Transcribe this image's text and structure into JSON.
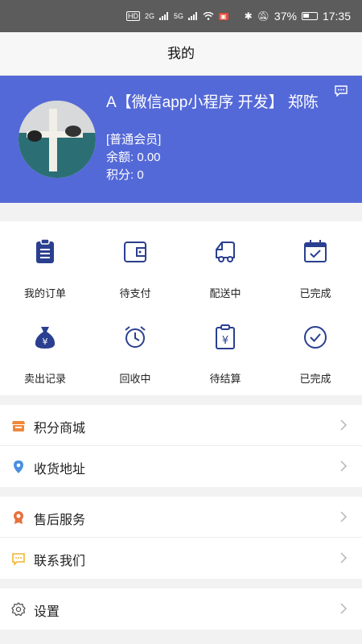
{
  "status_bar": {
    "battery_percent": "37%",
    "time": "17:35",
    "network_labels": [
      "HD",
      "2G",
      "5G"
    ]
  },
  "header": {
    "title": "我的"
  },
  "profile": {
    "name": "A【微信app小程序 开发】 郑陈",
    "level": "[普通会员]",
    "balance": "余额: 0.00",
    "points": "积分: 0"
  },
  "orders": {
    "row1": [
      {
        "label": "我的订单",
        "icon": "clipboard-list-icon"
      },
      {
        "label": "待支付",
        "icon": "wallet-icon"
      },
      {
        "label": "配送中",
        "icon": "truck-icon"
      },
      {
        "label": "已完成",
        "icon": "calendar-check-icon"
      }
    ],
    "row2": [
      {
        "label": "卖出记录",
        "icon": "money-bag-icon"
      },
      {
        "label": "回收中",
        "icon": "alarm-clock-icon"
      },
      {
        "label": "待结算",
        "icon": "yuan-clipboard-icon"
      },
      {
        "label": "已完成",
        "icon": "check-circle-icon"
      }
    ]
  },
  "menu": {
    "group1": [
      {
        "label": "积分商城",
        "icon": "shop-icon",
        "color": "#f0883a"
      },
      {
        "label": "收货地址",
        "icon": "location-pin-icon",
        "color": "#4a8fe0"
      }
    ],
    "group2": [
      {
        "label": "售后服务",
        "icon": "badge-icon",
        "color": "#e8703a"
      },
      {
        "label": "联系我们",
        "icon": "chat-icon",
        "color": "#f2b530"
      }
    ],
    "group3": [
      {
        "label": "设置",
        "icon": "gear-icon",
        "color": "#555555"
      }
    ]
  },
  "colors": {
    "accent": "#5469d8",
    "icon_blue": "#2a3f8f"
  }
}
